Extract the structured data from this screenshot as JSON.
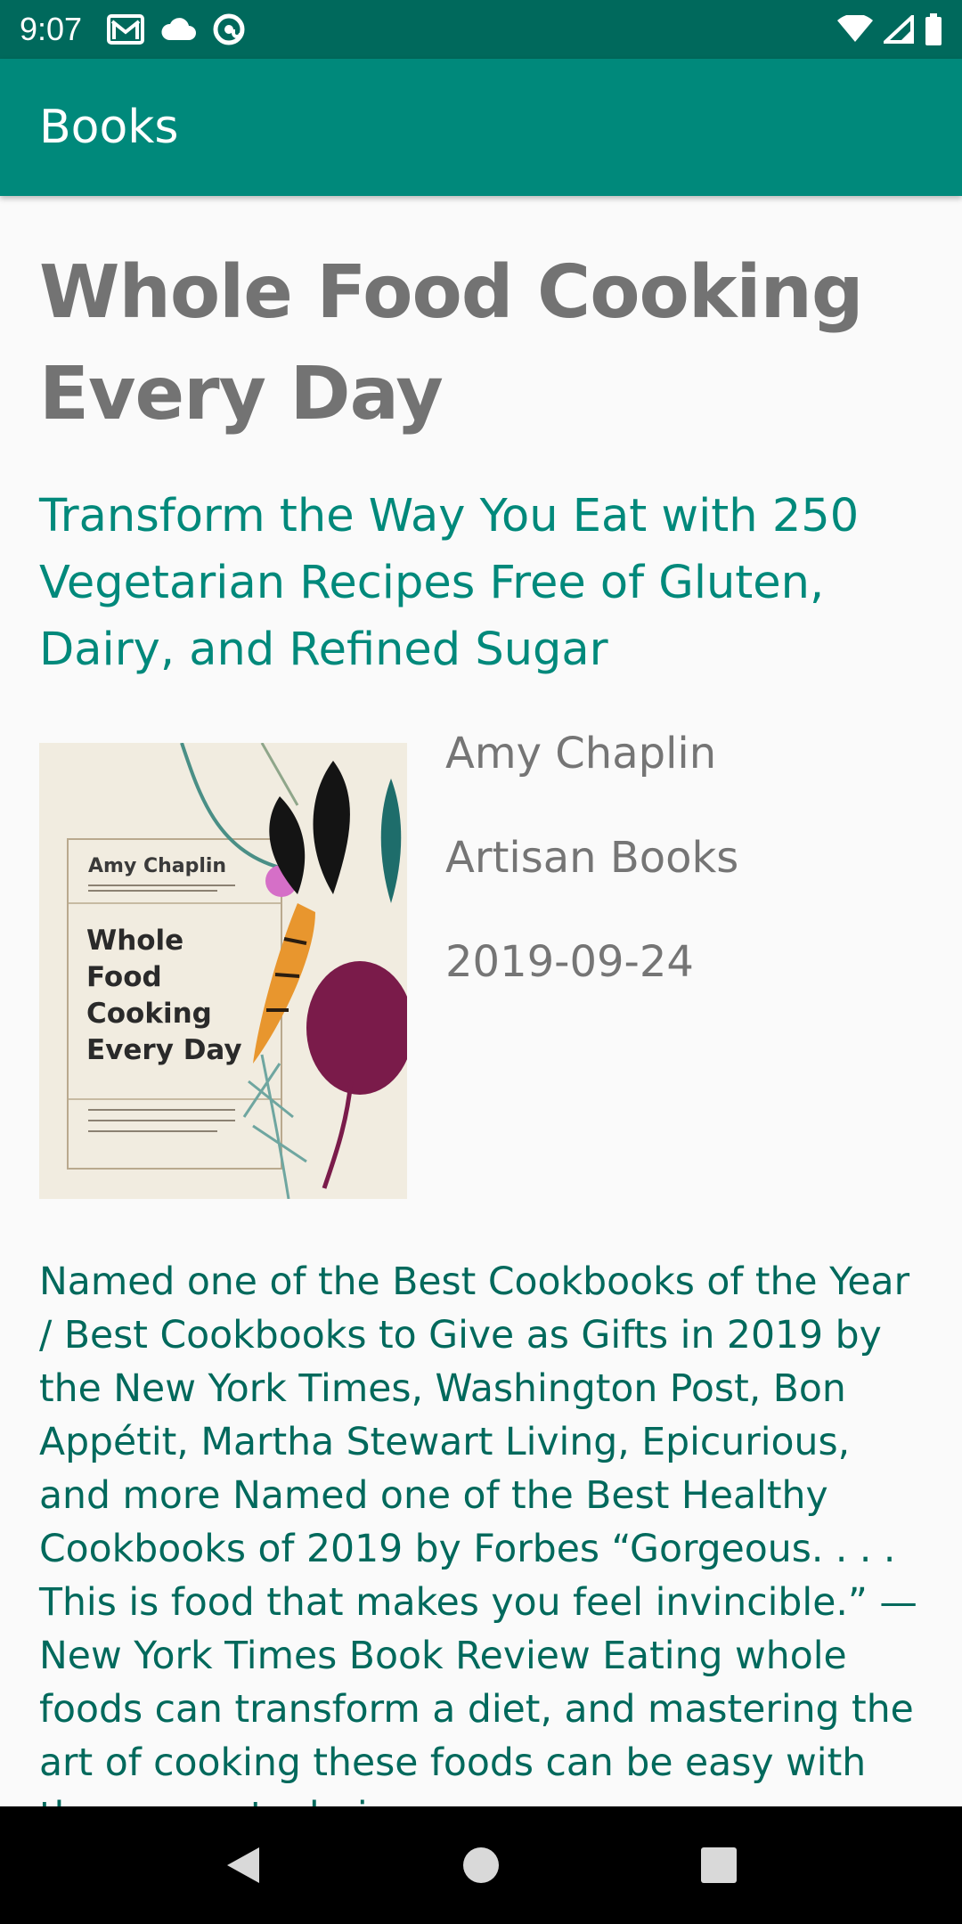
{
  "status_bar": {
    "time": "9:07",
    "icons_left": [
      "gmail-icon",
      "cloud-icon",
      "at-sign-icon"
    ],
    "icons_right": [
      "wifi-icon",
      "signal-icon",
      "battery-icon"
    ]
  },
  "app_bar": {
    "title": "Books"
  },
  "book": {
    "title": "Whole Food Cooking Every Day",
    "subtitle": "Transform the Way You Eat with 250 Vegetarian Recipes Free of Gluten, Dairy, and Refined Sugar",
    "author": "Amy Chaplin",
    "publisher": "Artisan Books",
    "published_date": "2019-09-24",
    "cover": {
      "author": "Amy Chaplin",
      "title_lines": [
        "Whole",
        "Food",
        "Cooking",
        "Every Day"
      ]
    },
    "description": "Named one of the Best Cookbooks of the Year / Best Cookbooks to Give as Gifts in 2019 by the New York Times, Washington Post, Bon Appétit, Martha Stewart Living, Epicurious, and more Named one of the Best Healthy Cookbooks of 2019 by Forbes “Gorgeous. . . . This is food that makes you feel invincible.” —New York Times Book Review Eating whole foods can transform a diet, and mastering the art of cooking these foods can be easy with the proper techniques"
  },
  "colors": {
    "status_bar": "#00695c",
    "app_bar": "#00897b",
    "accent": "#00897b",
    "description_text": "#00695c",
    "title_text": "#737373"
  },
  "nav_bar": {
    "buttons": [
      "back-icon",
      "home-icon",
      "recents-icon"
    ]
  }
}
